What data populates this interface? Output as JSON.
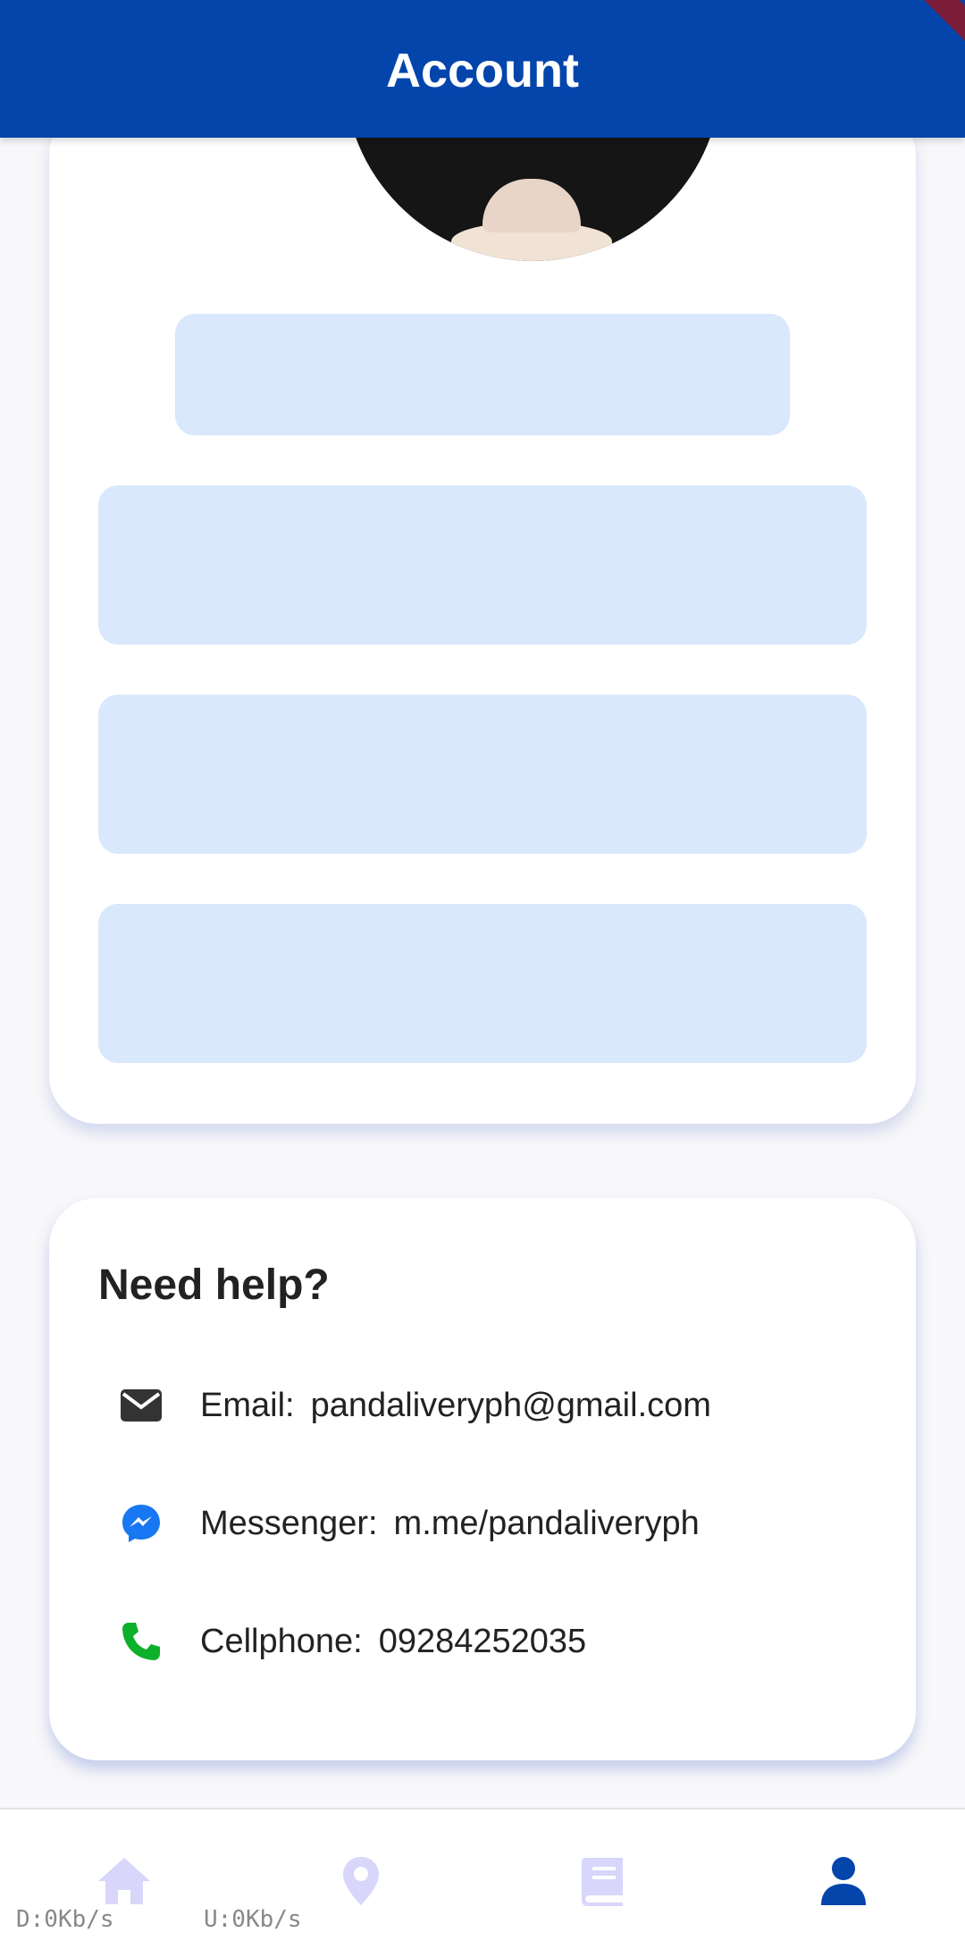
{
  "header": {
    "title": "Account"
  },
  "help": {
    "title": "Need help?",
    "contacts": [
      {
        "label": "Email:",
        "value": "pandaliveryph@gmail.com",
        "icon": "envelope-icon"
      },
      {
        "label": "Messenger:",
        "value": "m.me/pandaliveryph",
        "icon": "messenger-icon"
      },
      {
        "label": "Cellphone:",
        "value": "09284252035",
        "icon": "phone-icon"
      }
    ]
  },
  "nav": {
    "items": [
      {
        "name": "home",
        "icon": "home-icon",
        "active": false
      },
      {
        "name": "location",
        "icon": "map-pin-icon",
        "active": false
      },
      {
        "name": "bookings",
        "icon": "book-icon",
        "active": false
      },
      {
        "name": "account",
        "icon": "person-icon",
        "active": true
      }
    ]
  },
  "status": {
    "download": "D:0Kb/s",
    "upload": "U:0Kb/s"
  },
  "colors": {
    "appbar": "#0345ab",
    "skeleton": "#d9e8fc",
    "nav_inactive": "#d8d6fb",
    "nav_active": "#0345ab",
    "phone": "#0db02b",
    "messenger": "#1877f2"
  }
}
